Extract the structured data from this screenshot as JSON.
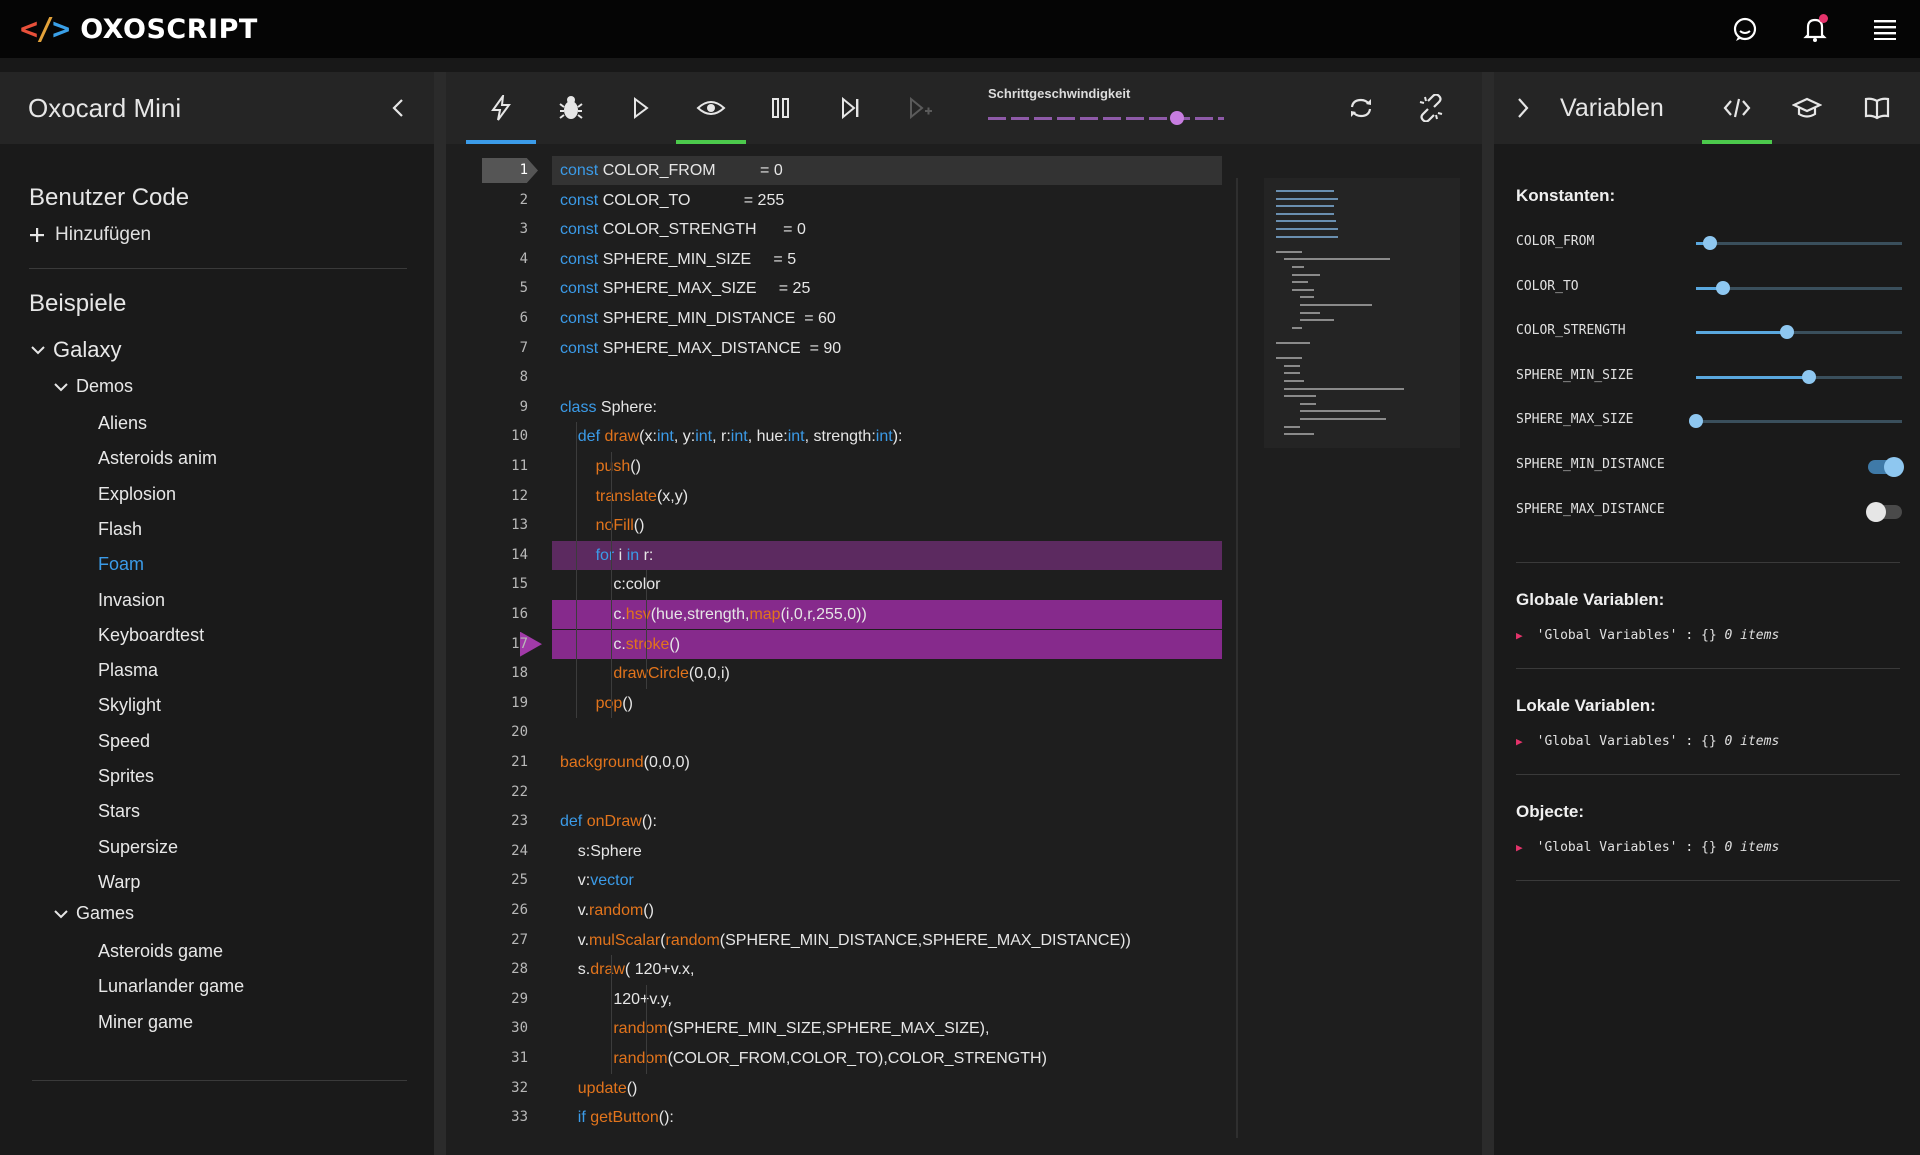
{
  "app": {
    "name": "OXOSCRIPT"
  },
  "left": {
    "title": "Oxocard Mini",
    "user_code_title": "Benutzer Code",
    "add_label": "Hinzufügen",
    "examples_title": "Beispiele",
    "galaxy": "Galaxy",
    "demos": "Demos",
    "demo_items": [
      "Aliens",
      "Asteroids anim",
      "Explosion",
      "Flash",
      "Foam",
      "Invasion",
      "Keyboardtest",
      "Plasma",
      "Skylight",
      "Speed",
      "Sprites",
      "Stars",
      "Supersize",
      "Warp"
    ],
    "active_item": "Foam",
    "games": "Games",
    "game_items": [
      "Asteroids game",
      "Lunarlander game",
      "Miner game"
    ]
  },
  "toolbar": {
    "speed_label": "Schrittgeschwindigkeit",
    "speed_level": 0.8
  },
  "editor": {
    "current_line": 1,
    "lines": [
      "const COLOR_FROM          = 0",
      "const COLOR_TO            = 255",
      "const COLOR_STRENGTH      = 0",
      "const SPHERE_MIN_SIZE     = 5",
      "const SPHERE_MAX_SIZE     = 25",
      "const SPHERE_MIN_DISTANCE  = 60",
      "const SPHERE_MAX_DISTANCE  = 90",
      "",
      "class Sphere:",
      "    def draw(x:int, y:int, r:int, hue:int, strength:int):",
      "        push()",
      "        translate(x,y)",
      "        noFill()",
      "        for i in r:",
      "            c:color",
      "            c.hsv(hue,strength,map(i,0,r,255,0))",
      "            c.stroke()",
      "            drawCircle(0,0,i)",
      "        pop()",
      "",
      "background(0,0,0)",
      "",
      "def onDraw():",
      "    s:Sphere",
      "    v:vector",
      "    v.random()",
      "    v.mulScalar(random(SPHERE_MIN_DISTANCE,SPHERE_MAX_DISTANCE))",
      "    s.draw( 120+v.x,",
      "            120+v.y,",
      "            random(SPHERE_MIN_SIZE,SPHERE_MAX_SIZE),",
      "            random(COLOR_FROM,COLOR_TO),COLOR_STRENGTH)",
      "    update()",
      "    if getButton():"
    ]
  },
  "right": {
    "title": "Variablen",
    "constants_title": "Konstanten:",
    "constants": [
      {
        "name": "COLOR_FROM",
        "kind": "slider",
        "value": 0.07
      },
      {
        "name": "COLOR_TO",
        "kind": "slider",
        "value": 0.13
      },
      {
        "name": "COLOR_STRENGTH",
        "kind": "slider",
        "value": 0.44
      },
      {
        "name": "SPHERE_MIN_SIZE",
        "kind": "slider",
        "value": 0.55
      },
      {
        "name": "SPHERE_MAX_SIZE",
        "kind": "slider",
        "value": 0.0
      },
      {
        "name": "SPHERE_MIN_DISTANCE",
        "kind": "toggle",
        "on": true
      },
      {
        "name": "SPHERE_MAX_DISTANCE",
        "kind": "toggle",
        "on": false
      }
    ],
    "globals_title": "Globale Variablen:",
    "locals_title": "Lokale Variablen:",
    "objects_title": "Objecte:",
    "var_key": "'Global Variables'",
    "var_sep": " : {} ",
    "var_count": "0 items"
  },
  "colors": {
    "accent_green": "#4cc94c",
    "accent_blue": "#3b9be8",
    "magenta_hl": "#9a2a9c",
    "current_line_hl": "#333333"
  }
}
